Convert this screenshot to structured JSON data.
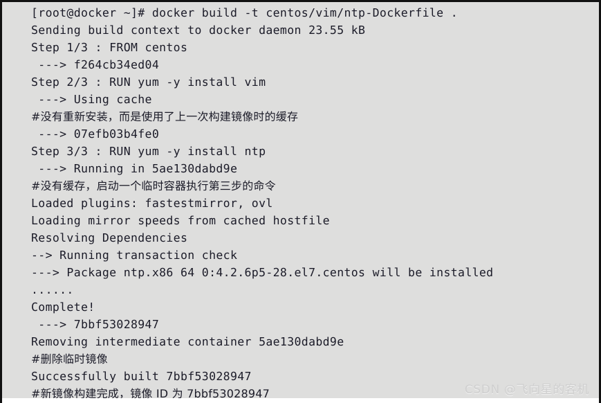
{
  "window": {
    "title": "Docker build terminal output",
    "background_color": "#dededd",
    "text_color": "#1b1b28",
    "border_color": "#111111"
  },
  "terminal": {
    "prompt": "[root@docker ~]#",
    "command": "docker build -t centos/vim/ntp-Dockerfile .",
    "lines": [
      {
        "text": "[root@docker ~]# docker build -t centos/vim/ntp-Dockerfile .",
        "kind": "command"
      },
      {
        "text": "Sending build context to docker daemon 23.55 kB",
        "kind": "output"
      },
      {
        "text": "Step 1/3 : FROM centos",
        "kind": "output"
      },
      {
        "text": " ---> f264cb34ed04",
        "kind": "output"
      },
      {
        "text": "Step 2/3 : RUN yum -y install vim",
        "kind": "output"
      },
      {
        "text": " ---> Using cache",
        "kind": "output"
      },
      {
        "text": "#没有重新安装，而是使用了上一次构建镜像时的缓存",
        "kind": "comment"
      },
      {
        "text": " ---> 07efb03b4fe0",
        "kind": "output"
      },
      {
        "text": "Step 3/3 : RUN yum -y install ntp",
        "kind": "output"
      },
      {
        "text": " ---> Running in 5ae130dabd9e",
        "kind": "output"
      },
      {
        "text": "#没有缓存，启动一个临时容器执行第三步的命令",
        "kind": "comment"
      },
      {
        "text": "Loaded plugins: fastestmirror, ovl",
        "kind": "output"
      },
      {
        "text": "Loading mirror speeds from cached hostfile",
        "kind": "output"
      },
      {
        "text": "Resolving Dependencies",
        "kind": "output"
      },
      {
        "text": "--> Running transaction check",
        "kind": "output"
      },
      {
        "text": "---> Package ntp.x86 64 0:4.2.6p5-28.el7.centos will be installed",
        "kind": "output"
      },
      {
        "text": "......",
        "kind": "output"
      },
      {
        "text": "Complete!",
        "kind": "output"
      },
      {
        "text": " ---> 7bbf53028947",
        "kind": "output"
      },
      {
        "text": "Removing intermediate container 5ae130dabd9e",
        "kind": "output"
      },
      {
        "text": "#删除临时镜像",
        "kind": "comment"
      },
      {
        "text": "Successfully built 7bbf53028947",
        "kind": "output"
      },
      {
        "text": "#新镜像构建完成，镜像 ID 为 7bbf53028947",
        "kind": "comment"
      }
    ],
    "image_id": "7bbf53028947",
    "base_image_id": "f264cb34ed04",
    "cached_layer_id": "07efb03b4fe0",
    "intermediate_container_id": "5ae130dabd9e",
    "build_context_size": "23.55 kB",
    "steps_total": "3"
  },
  "watermark": {
    "text": "CSDN @飞向星的客机",
    "color": "#cfcfcf"
  }
}
